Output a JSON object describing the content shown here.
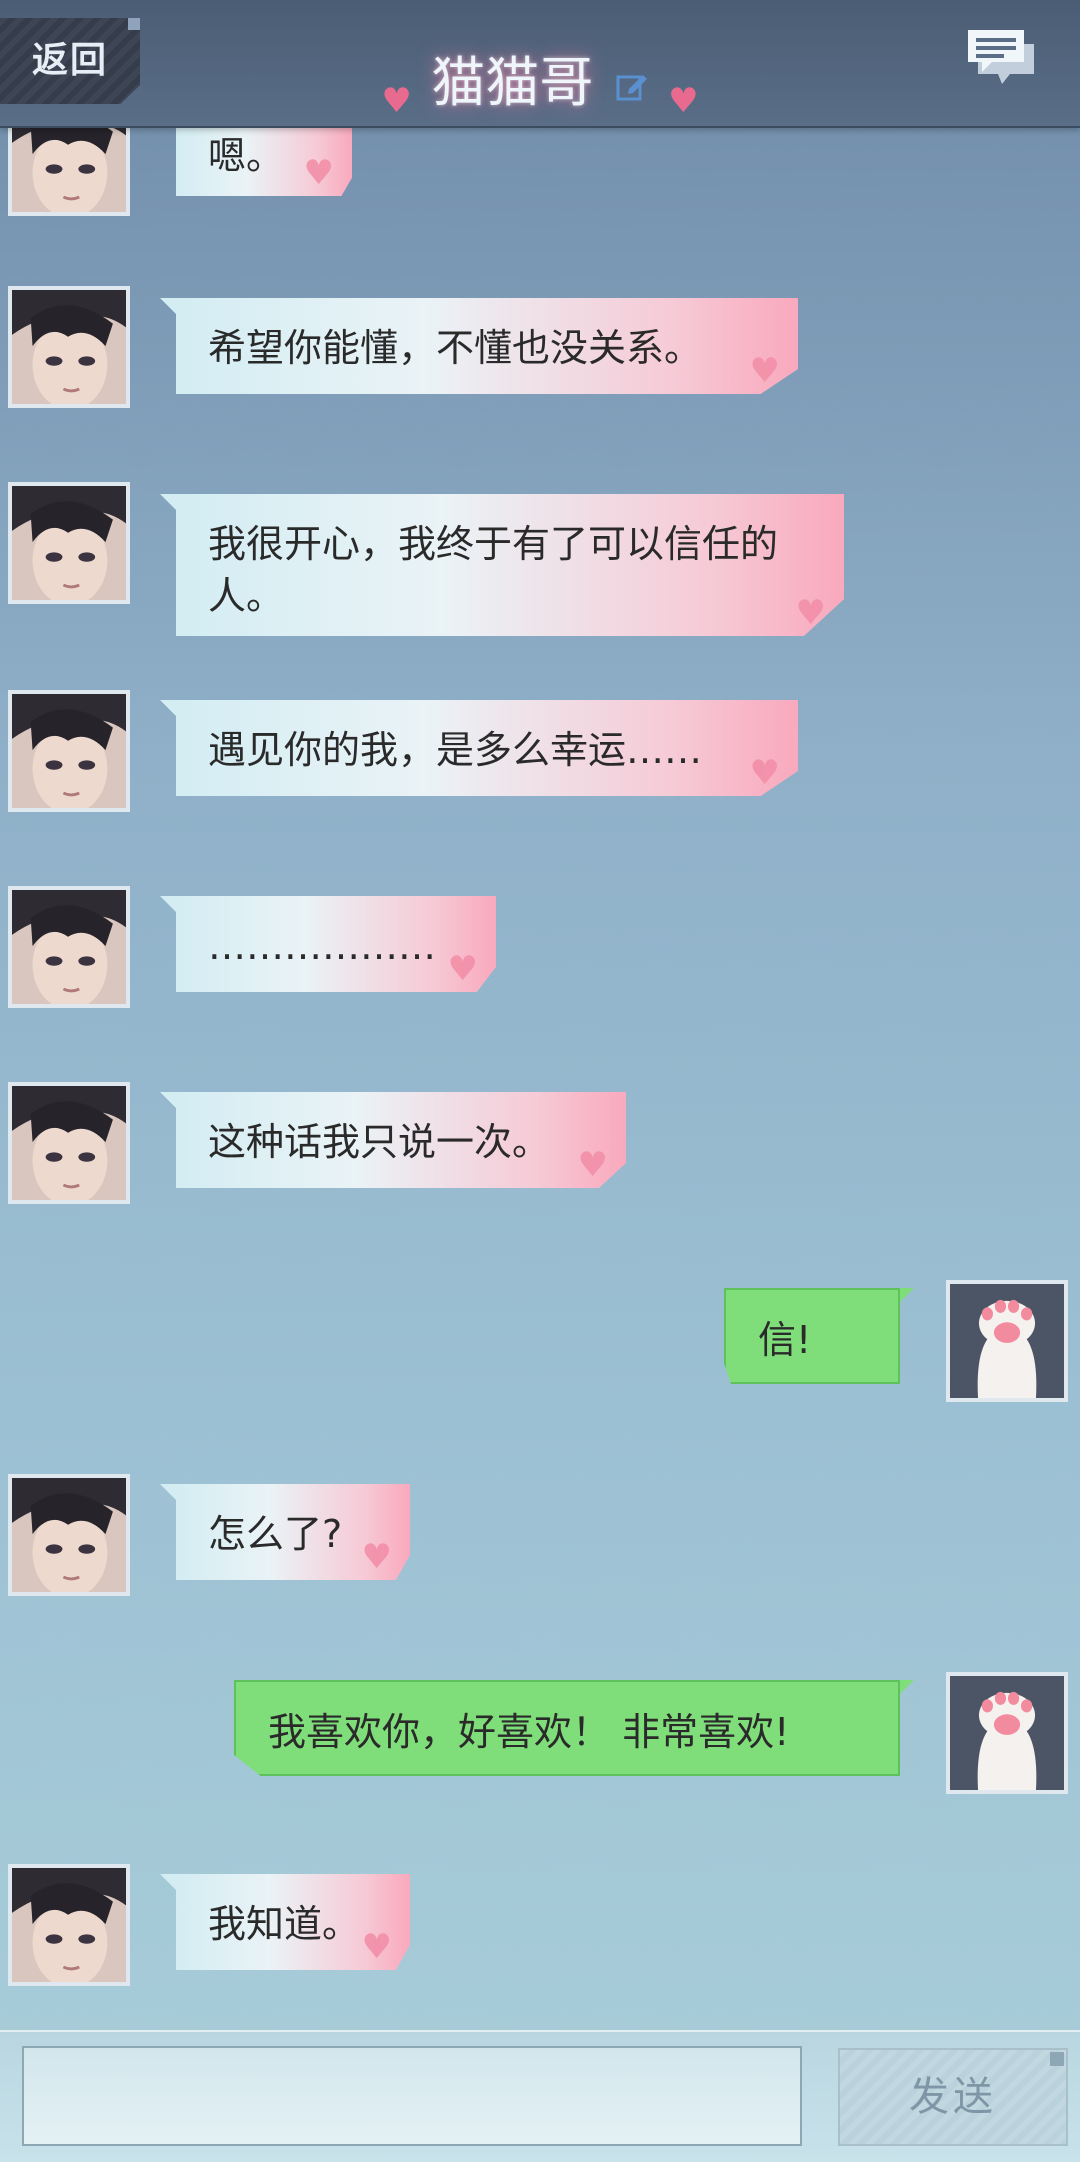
{
  "header": {
    "back_label": "返回",
    "title": "猫猫哥",
    "title_icon": "edit-icon",
    "right_icon": "chat-list-icon"
  },
  "colors": {
    "header_bg": "#4b5d74",
    "incoming_bubble_start": "#d3edf3",
    "incoming_bubble_end": "#f9a9bd",
    "outgoing_bubble": "#7fde7a",
    "heart": "#f28fa8"
  },
  "messages": [
    {
      "side": "in",
      "text": "嗯。",
      "avatar": "character-avatar"
    },
    {
      "side": "in",
      "text": "希望你能懂，不懂也没关系。",
      "avatar": "character-avatar"
    },
    {
      "side": "in",
      "text": "我很开心，我终于有了可以信任的人。",
      "avatar": "character-avatar"
    },
    {
      "side": "in",
      "text": "遇见你的我，是多么幸运……",
      "avatar": "character-avatar"
    },
    {
      "side": "in",
      "text": "………………",
      "avatar": "character-avatar"
    },
    {
      "side": "in",
      "text": "这种话我只说一次。",
      "avatar": "character-avatar"
    },
    {
      "side": "out",
      "text": "信!",
      "avatar": "cat-paw-avatar"
    },
    {
      "side": "in",
      "text": "怎么了?",
      "avatar": "character-avatar"
    },
    {
      "side": "out",
      "text": "我喜欢你，好喜欢！ 非常喜欢!",
      "avatar": "cat-paw-avatar"
    },
    {
      "side": "in",
      "text": "我知道。",
      "avatar": "character-avatar"
    }
  ],
  "input": {
    "placeholder": "",
    "value": "",
    "send_label": "发送"
  }
}
